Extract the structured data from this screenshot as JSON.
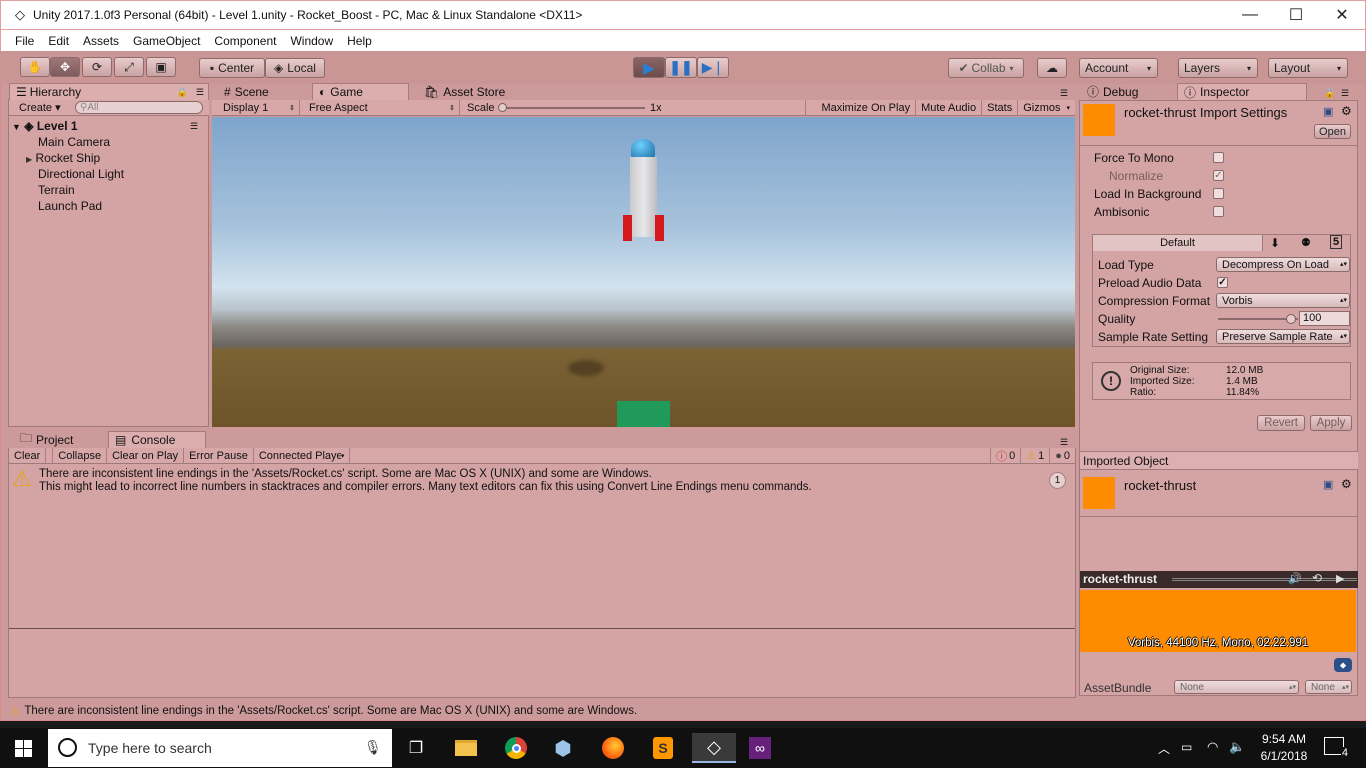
{
  "window": {
    "title": "Unity 2017.1.0f3 Personal (64bit) - Level 1.unity - Rocket_Boost - PC, Mac & Linux Standalone <DX11>",
    "minimize": "—",
    "maximize": "☐",
    "close": "✕"
  },
  "menu": [
    "File",
    "Edit",
    "Assets",
    "GameObject",
    "Component",
    "Window",
    "Help"
  ],
  "toolbar": {
    "center": "Center",
    "local": "Local",
    "collab": "Collab",
    "account": "Account",
    "layers": "Layers",
    "layout": "Layout"
  },
  "hierarchy": {
    "tab": "Hierarchy",
    "create": "Create",
    "search_placeholder": "All",
    "scene": "Level 1",
    "items": [
      "Main Camera",
      "Rocket Ship",
      "Directional Light",
      "Terrain",
      "Launch Pad"
    ]
  },
  "center_tabs": [
    "Scene",
    "Game",
    "Asset Store"
  ],
  "game_bar": {
    "display": "Display 1",
    "aspect": "Free Aspect",
    "scale_label": "Scale",
    "scale_value": "1x",
    "maximize": "Maximize On Play",
    "mute": "Mute Audio",
    "stats": "Stats",
    "gizmos": "Gizmos"
  },
  "bottom_tabs": [
    "Project",
    "Console"
  ],
  "console": {
    "clear": "Clear",
    "collapse": "Collapse",
    "clear_on_play": "Clear on Play",
    "error_pause": "Error Pause",
    "connected": "Connected Player",
    "count_errors": "0",
    "count_warnings": "1",
    "count_logs": "0",
    "message_line1": "There are inconsistent line endings in the 'Assets/Rocket.cs' script. Some are Mac OS X (UNIX) and some are Windows.",
    "message_line2": "This might lead to incorrect line numbers in stacktraces and compiler errors. Many text editors can fix this using Convert Line Endings menu commands.",
    "message_count": "1"
  },
  "status_bar": "There are inconsistent line endings in the 'Assets/Rocket.cs' script. Some are Mac OS X (UNIX) and some are Windows.",
  "inspector": {
    "tab_debug": "Debug",
    "tab_inspector": "Inspector",
    "title": "rocket-thrust Import Settings",
    "open": "Open",
    "force_mono": "Force To Mono",
    "normalize": "Normalize",
    "load_bg": "Load In Background",
    "ambisonic": "Ambisonic",
    "platform_default": "Default",
    "load_type_label": "Load Type",
    "load_type_value": "Decompress On Load",
    "preload_label": "Preload Audio Data",
    "compression_label": "Compression Format",
    "compression_value": "Vorbis",
    "quality_label": "Quality",
    "quality_value": "100",
    "quality_fraction": 0.97,
    "sample_rate_label": "Sample Rate Setting",
    "sample_rate_value": "Preserve Sample Rate",
    "orig_size_label": "Original Size:",
    "orig_size_value": "12.0 MB",
    "imp_size_label": "Imported Size:",
    "imp_size_value": "1.4 MB",
    "ratio_label": "Ratio:",
    "ratio_value": "11.84%",
    "revert": "Revert",
    "apply": "Apply",
    "imported_object": "Imported Object",
    "object_name": "rocket-thrust",
    "preview_name": "rocket-thrust",
    "preview_info": "Vorbis, 44100 Hz, Mono, 02:22.991",
    "assetbundle_label": "AssetBundle",
    "assetbundle_value": "None",
    "assetbundle_variant": "None"
  },
  "taskbar": {
    "search_placeholder": "Type here to search",
    "time": "9:54 AM",
    "date": "6/1/2018",
    "notifications": "4"
  },
  "colors": {
    "editor_tint": "#cc9a9a",
    "accent_orange": "#ff8c00",
    "play_blue": "#2a7fd4"
  }
}
